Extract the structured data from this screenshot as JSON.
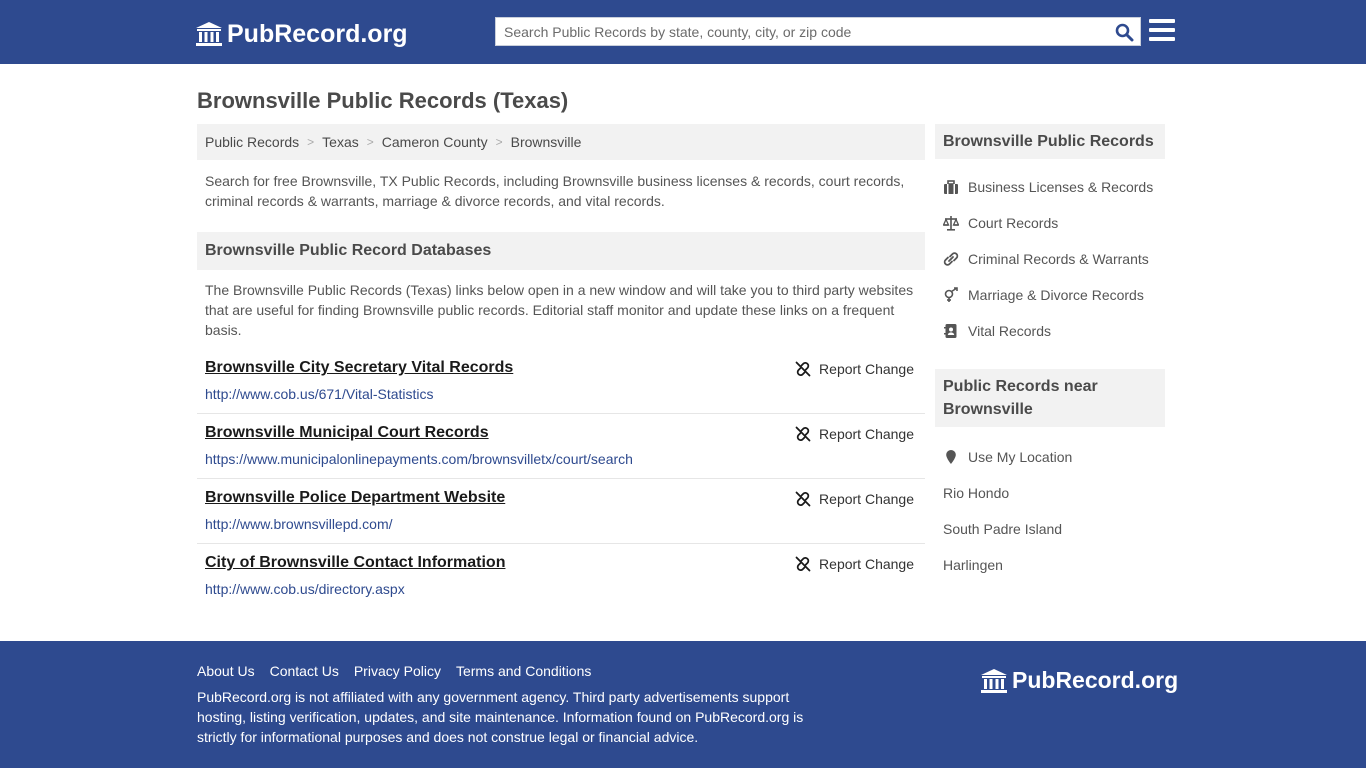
{
  "header": {
    "logo_text": "PubRecord.org",
    "search_placeholder": "Search Public Records by state, county, city, or zip code"
  },
  "main": {
    "title": "Brownsville Public Records (Texas)",
    "breadcrumb": [
      "Public Records",
      "Texas",
      "Cameron County",
      "Brownsville"
    ],
    "breadcrumb_separator": ">",
    "intro": "Search for free Brownsville, TX Public Records, including Brownsville business licenses & records, court records, criminal records & warrants, marriage & divorce records, and vital records.",
    "section_title": "Brownsville Public Record Databases",
    "section_desc": "The Brownsville Public Records (Texas) links below open in a new window and will take you to third party websites that are useful for finding Brownsville public records. Editorial staff monitor and update these links on a frequent basis.",
    "report_label": "Report Change",
    "records": [
      {
        "title": "Brownsville City Secretary Vital Records",
        "url": "http://www.cob.us/671/Vital-Statistics"
      },
      {
        "title": "Brownsville Municipal Court Records",
        "url": "https://www.municipalonlinepayments.com/brownsvilletx/court/search"
      },
      {
        "title": "Brownsville Police Department Website",
        "url": "http://www.brownsvillepd.com/"
      },
      {
        "title": "City of Brownsville Contact Information",
        "url": "http://www.cob.us/directory.aspx"
      }
    ]
  },
  "sidebar": {
    "records_title": "Brownsville Public Records",
    "record_links": [
      {
        "label": "Business Licenses & Records",
        "icon": "briefcase-icon"
      },
      {
        "label": "Court Records",
        "icon": "scale-icon"
      },
      {
        "label": "Criminal Records & Warrants",
        "icon": "link-icon"
      },
      {
        "label": "Marriage & Divorce Records",
        "icon": "gender-icon"
      },
      {
        "label": "Vital Records",
        "icon": "address-book-icon"
      }
    ],
    "nearby_title": "Public Records near Brownsville",
    "use_location_label": "Use My Location",
    "nearby": [
      "Rio Hondo",
      "South Padre Island",
      "Harlingen"
    ]
  },
  "footer": {
    "links": [
      "About Us",
      "Contact Us",
      "Privacy Policy",
      "Terms and Conditions"
    ],
    "disclaimer": "PubRecord.org is not affiliated with any government agency. Third party advertisements support hosting, listing verification, updates, and site maintenance. Information found on PubRecord.org is strictly for informational purposes and does not construe legal or financial advice.",
    "logo_text": "PubRecord.org"
  },
  "colors": {
    "brand": "#2e4a8f",
    "link": "#2e4a8f",
    "panel": "#f2f2f2"
  }
}
